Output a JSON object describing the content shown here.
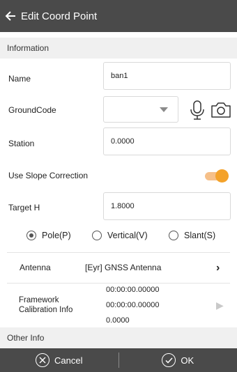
{
  "header": {
    "title": "Edit Coord Point",
    "back_icon": "arrow-left-icon"
  },
  "sections": {
    "information": "Information",
    "other_info": "Other Info"
  },
  "fields": {
    "name": {
      "label": "Name",
      "value": "ban1"
    },
    "ground_code": {
      "label": "GroundCode",
      "value": ""
    },
    "station": {
      "label": "Station",
      "value": "0.0000"
    },
    "slope": {
      "label": "Use Slope Correction",
      "enabled": true
    },
    "target_h": {
      "label": "Target H",
      "value": "1.8000"
    }
  },
  "measure_type": {
    "options": [
      "Pole(P)",
      "Vertical(V)",
      "Slant(S)"
    ],
    "selected": "Pole(P)"
  },
  "antenna": {
    "label": "Antenna",
    "value": "[Eyr] GNSS Antenna"
  },
  "framework": {
    "label": "Framework Calibration Info",
    "values": [
      "00:00:00.00000",
      "00:00:00.00000",
      "0.0000"
    ]
  },
  "footer": {
    "cancel": "Cancel",
    "ok": "OK"
  },
  "colors": {
    "bar": "#4a4a4a",
    "toggle": "#f4a22a",
    "section_bg": "#f0f0f0"
  }
}
